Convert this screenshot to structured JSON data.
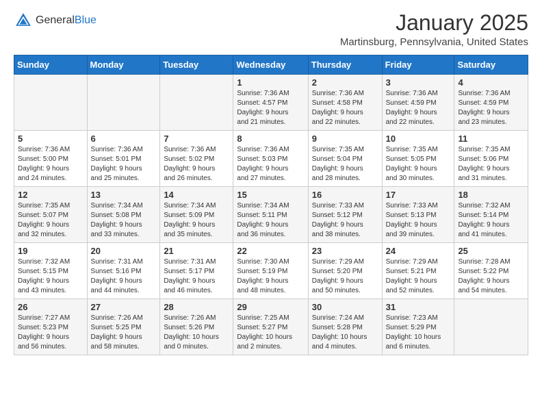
{
  "header": {
    "logo_general": "General",
    "logo_blue": "Blue",
    "month_title": "January 2025",
    "location": "Martinsburg, Pennsylvania, United States"
  },
  "weekdays": [
    "Sunday",
    "Monday",
    "Tuesday",
    "Wednesday",
    "Thursday",
    "Friday",
    "Saturday"
  ],
  "weeks": [
    [
      {
        "day": "",
        "info": ""
      },
      {
        "day": "",
        "info": ""
      },
      {
        "day": "",
        "info": ""
      },
      {
        "day": "1",
        "info": "Sunrise: 7:36 AM\nSunset: 4:57 PM\nDaylight: 9 hours\nand 21 minutes."
      },
      {
        "day": "2",
        "info": "Sunrise: 7:36 AM\nSunset: 4:58 PM\nDaylight: 9 hours\nand 22 minutes."
      },
      {
        "day": "3",
        "info": "Sunrise: 7:36 AM\nSunset: 4:59 PM\nDaylight: 9 hours\nand 22 minutes."
      },
      {
        "day": "4",
        "info": "Sunrise: 7:36 AM\nSunset: 4:59 PM\nDaylight: 9 hours\nand 23 minutes."
      }
    ],
    [
      {
        "day": "5",
        "info": "Sunrise: 7:36 AM\nSunset: 5:00 PM\nDaylight: 9 hours\nand 24 minutes."
      },
      {
        "day": "6",
        "info": "Sunrise: 7:36 AM\nSunset: 5:01 PM\nDaylight: 9 hours\nand 25 minutes."
      },
      {
        "day": "7",
        "info": "Sunrise: 7:36 AM\nSunset: 5:02 PM\nDaylight: 9 hours\nand 26 minutes."
      },
      {
        "day": "8",
        "info": "Sunrise: 7:36 AM\nSunset: 5:03 PM\nDaylight: 9 hours\nand 27 minutes."
      },
      {
        "day": "9",
        "info": "Sunrise: 7:35 AM\nSunset: 5:04 PM\nDaylight: 9 hours\nand 28 minutes."
      },
      {
        "day": "10",
        "info": "Sunrise: 7:35 AM\nSunset: 5:05 PM\nDaylight: 9 hours\nand 30 minutes."
      },
      {
        "day": "11",
        "info": "Sunrise: 7:35 AM\nSunset: 5:06 PM\nDaylight: 9 hours\nand 31 minutes."
      }
    ],
    [
      {
        "day": "12",
        "info": "Sunrise: 7:35 AM\nSunset: 5:07 PM\nDaylight: 9 hours\nand 32 minutes."
      },
      {
        "day": "13",
        "info": "Sunrise: 7:34 AM\nSunset: 5:08 PM\nDaylight: 9 hours\nand 33 minutes."
      },
      {
        "day": "14",
        "info": "Sunrise: 7:34 AM\nSunset: 5:09 PM\nDaylight: 9 hours\nand 35 minutes."
      },
      {
        "day": "15",
        "info": "Sunrise: 7:34 AM\nSunset: 5:11 PM\nDaylight: 9 hours\nand 36 minutes."
      },
      {
        "day": "16",
        "info": "Sunrise: 7:33 AM\nSunset: 5:12 PM\nDaylight: 9 hours\nand 38 minutes."
      },
      {
        "day": "17",
        "info": "Sunrise: 7:33 AM\nSunset: 5:13 PM\nDaylight: 9 hours\nand 39 minutes."
      },
      {
        "day": "18",
        "info": "Sunrise: 7:32 AM\nSunset: 5:14 PM\nDaylight: 9 hours\nand 41 minutes."
      }
    ],
    [
      {
        "day": "19",
        "info": "Sunrise: 7:32 AM\nSunset: 5:15 PM\nDaylight: 9 hours\nand 43 minutes."
      },
      {
        "day": "20",
        "info": "Sunrise: 7:31 AM\nSunset: 5:16 PM\nDaylight: 9 hours\nand 44 minutes."
      },
      {
        "day": "21",
        "info": "Sunrise: 7:31 AM\nSunset: 5:17 PM\nDaylight: 9 hours\nand 46 minutes."
      },
      {
        "day": "22",
        "info": "Sunrise: 7:30 AM\nSunset: 5:19 PM\nDaylight: 9 hours\nand 48 minutes."
      },
      {
        "day": "23",
        "info": "Sunrise: 7:29 AM\nSunset: 5:20 PM\nDaylight: 9 hours\nand 50 minutes."
      },
      {
        "day": "24",
        "info": "Sunrise: 7:29 AM\nSunset: 5:21 PM\nDaylight: 9 hours\nand 52 minutes."
      },
      {
        "day": "25",
        "info": "Sunrise: 7:28 AM\nSunset: 5:22 PM\nDaylight: 9 hours\nand 54 minutes."
      }
    ],
    [
      {
        "day": "26",
        "info": "Sunrise: 7:27 AM\nSunset: 5:23 PM\nDaylight: 9 hours\nand 56 minutes."
      },
      {
        "day": "27",
        "info": "Sunrise: 7:26 AM\nSunset: 5:25 PM\nDaylight: 9 hours\nand 58 minutes."
      },
      {
        "day": "28",
        "info": "Sunrise: 7:26 AM\nSunset: 5:26 PM\nDaylight: 10 hours\nand 0 minutes."
      },
      {
        "day": "29",
        "info": "Sunrise: 7:25 AM\nSunset: 5:27 PM\nDaylight: 10 hours\nand 2 minutes."
      },
      {
        "day": "30",
        "info": "Sunrise: 7:24 AM\nSunset: 5:28 PM\nDaylight: 10 hours\nand 4 minutes."
      },
      {
        "day": "31",
        "info": "Sunrise: 7:23 AM\nSunset: 5:29 PM\nDaylight: 10 hours\nand 6 minutes."
      },
      {
        "day": "",
        "info": ""
      }
    ]
  ]
}
